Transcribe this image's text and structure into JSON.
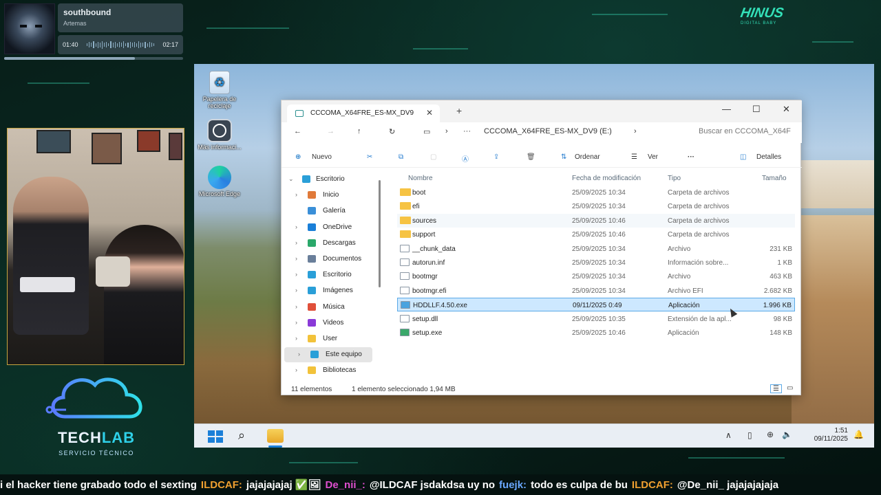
{
  "music": {
    "track": "southbound",
    "artist": "Artemas",
    "elapsed": "01:40",
    "total": "02:17",
    "progress": 0.73
  },
  "overlay": {
    "logo_line_left": "TECH",
    "logo_line_right": "LAB",
    "logo_sub": "SERVICIO TÉCNICO",
    "brand_top": "HINUS",
    "brand_sub": "DIGITAL BABY"
  },
  "desktop": {
    "icons": [
      {
        "label": "Papelera de reciclaje",
        "icon": "recycle-bin-icon"
      },
      {
        "label": "Más informaci...",
        "icon": "help-icon"
      },
      {
        "label": "Microsoft Edge",
        "icon": "edge-icon"
      }
    ]
  },
  "explorer": {
    "tab_title": "CCCOMA_X64FRE_ES-MX_DV9",
    "address_path": "CCCOMA_X64FRE_ES-MX_DV9 (E:)",
    "address_ellipsis": "···",
    "search_placeholder": "Buscar en CCCOMA_X64F",
    "commands": {
      "new": "Nuevo",
      "sort": "Ordenar",
      "view": "Ver",
      "more": "···",
      "details": "Detalles"
    },
    "nav": [
      {
        "label": "Escritorio",
        "color": "#2a9fd8",
        "expanded": true
      },
      {
        "label": "Inicio",
        "color": "#e07a3a"
      },
      {
        "label": "Galería",
        "color": "#3a8fd8"
      },
      {
        "label": "OneDrive",
        "color": "#1a7fd8"
      },
      {
        "label": "Descargas",
        "color": "#2aa86a"
      },
      {
        "label": "Documentos",
        "color": "#6a7f9a"
      },
      {
        "label": "Escritorio",
        "color": "#2a9fd8"
      },
      {
        "label": "Imágenes",
        "color": "#2a9fd8"
      },
      {
        "label": "Música",
        "color": "#e0503a"
      },
      {
        "label": "Videos",
        "color": "#8a3ad8"
      },
      {
        "label": "User",
        "color": "#f2c23a"
      },
      {
        "label": "Este equipo",
        "color": "#2a9fd8",
        "selected": true
      },
      {
        "label": "Bibliotecas",
        "color": "#f2c23a"
      }
    ],
    "columns": {
      "name": "Nombre",
      "modified": "Fecha de modificación",
      "type": "Tipo",
      "size": "Tamaño"
    },
    "files": [
      {
        "name": "boot",
        "date": "25/09/2025 10:34",
        "type": "Carpeta de archivos",
        "size": "",
        "kind": "folder"
      },
      {
        "name": "efi",
        "date": "25/09/2025 10:34",
        "type": "Carpeta de archivos",
        "size": "",
        "kind": "folder"
      },
      {
        "name": "sources",
        "date": "25/09/2025 10:46",
        "type": "Carpeta de archivos",
        "size": "",
        "kind": "folder",
        "hover": true
      },
      {
        "name": "support",
        "date": "25/09/2025 10:46",
        "type": "Carpeta de archivos",
        "size": "",
        "kind": "folder"
      },
      {
        "name": "__chunk_data",
        "date": "25/09/2025 10:34",
        "type": "Archivo",
        "size": "231 KB",
        "kind": "file"
      },
      {
        "name": "autorun.inf",
        "date": "25/09/2025 10:34",
        "type": "Información sobre...",
        "size": "1 KB",
        "kind": "settings"
      },
      {
        "name": "bootmgr",
        "date": "25/09/2025 10:34",
        "type": "Archivo",
        "size": "463 KB",
        "kind": "file"
      },
      {
        "name": "bootmgr.efi",
        "date": "25/09/2025 10:34",
        "type": "Archivo EFI",
        "size": "2.682 KB",
        "kind": "file"
      },
      {
        "name": "HDDLLF.4.50.exe",
        "date": "09/11/2025 0:49",
        "type": "Aplicación",
        "size": "1.996 KB",
        "kind": "app",
        "selected": true
      },
      {
        "name": "setup.dll",
        "date": "25/09/2025 10:35",
        "type": "Extensión de la apl...",
        "size": "98 KB",
        "kind": "file"
      },
      {
        "name": "setup.exe",
        "date": "25/09/2025 10:46",
        "type": "Aplicación",
        "size": "148 KB",
        "kind": "setup"
      }
    ],
    "status": {
      "count": "11 elementos",
      "selection": "1 elemento seleccionado  1,94 MB"
    }
  },
  "taskbar": {
    "time": "1:51",
    "date": "09/11/2025"
  },
  "chat": [
    {
      "user": "",
      "msg": "i el hacker tiene grabado todo el sexting"
    },
    {
      "user": "ILDCAF:",
      "msg": "jajajajajaj ✅🖼",
      "ucls": "u1"
    },
    {
      "user": "De_nii_:",
      "msg": "@ILDCAF jsdakdsa uy no",
      "ucls": "u2"
    },
    {
      "user": "fuejk:",
      "msg": "todo es culpa de bu",
      "ucls": "u3"
    },
    {
      "user": "ILDCAF:",
      "msg": "@De_nii_ jajajajajaja",
      "ucls": "u1"
    }
  ],
  "colors": {
    "accent": "#0067c0",
    "selection_bg": "#cde8ff",
    "folder": "#f6c343",
    "border_webcam": "#c9a640"
  }
}
